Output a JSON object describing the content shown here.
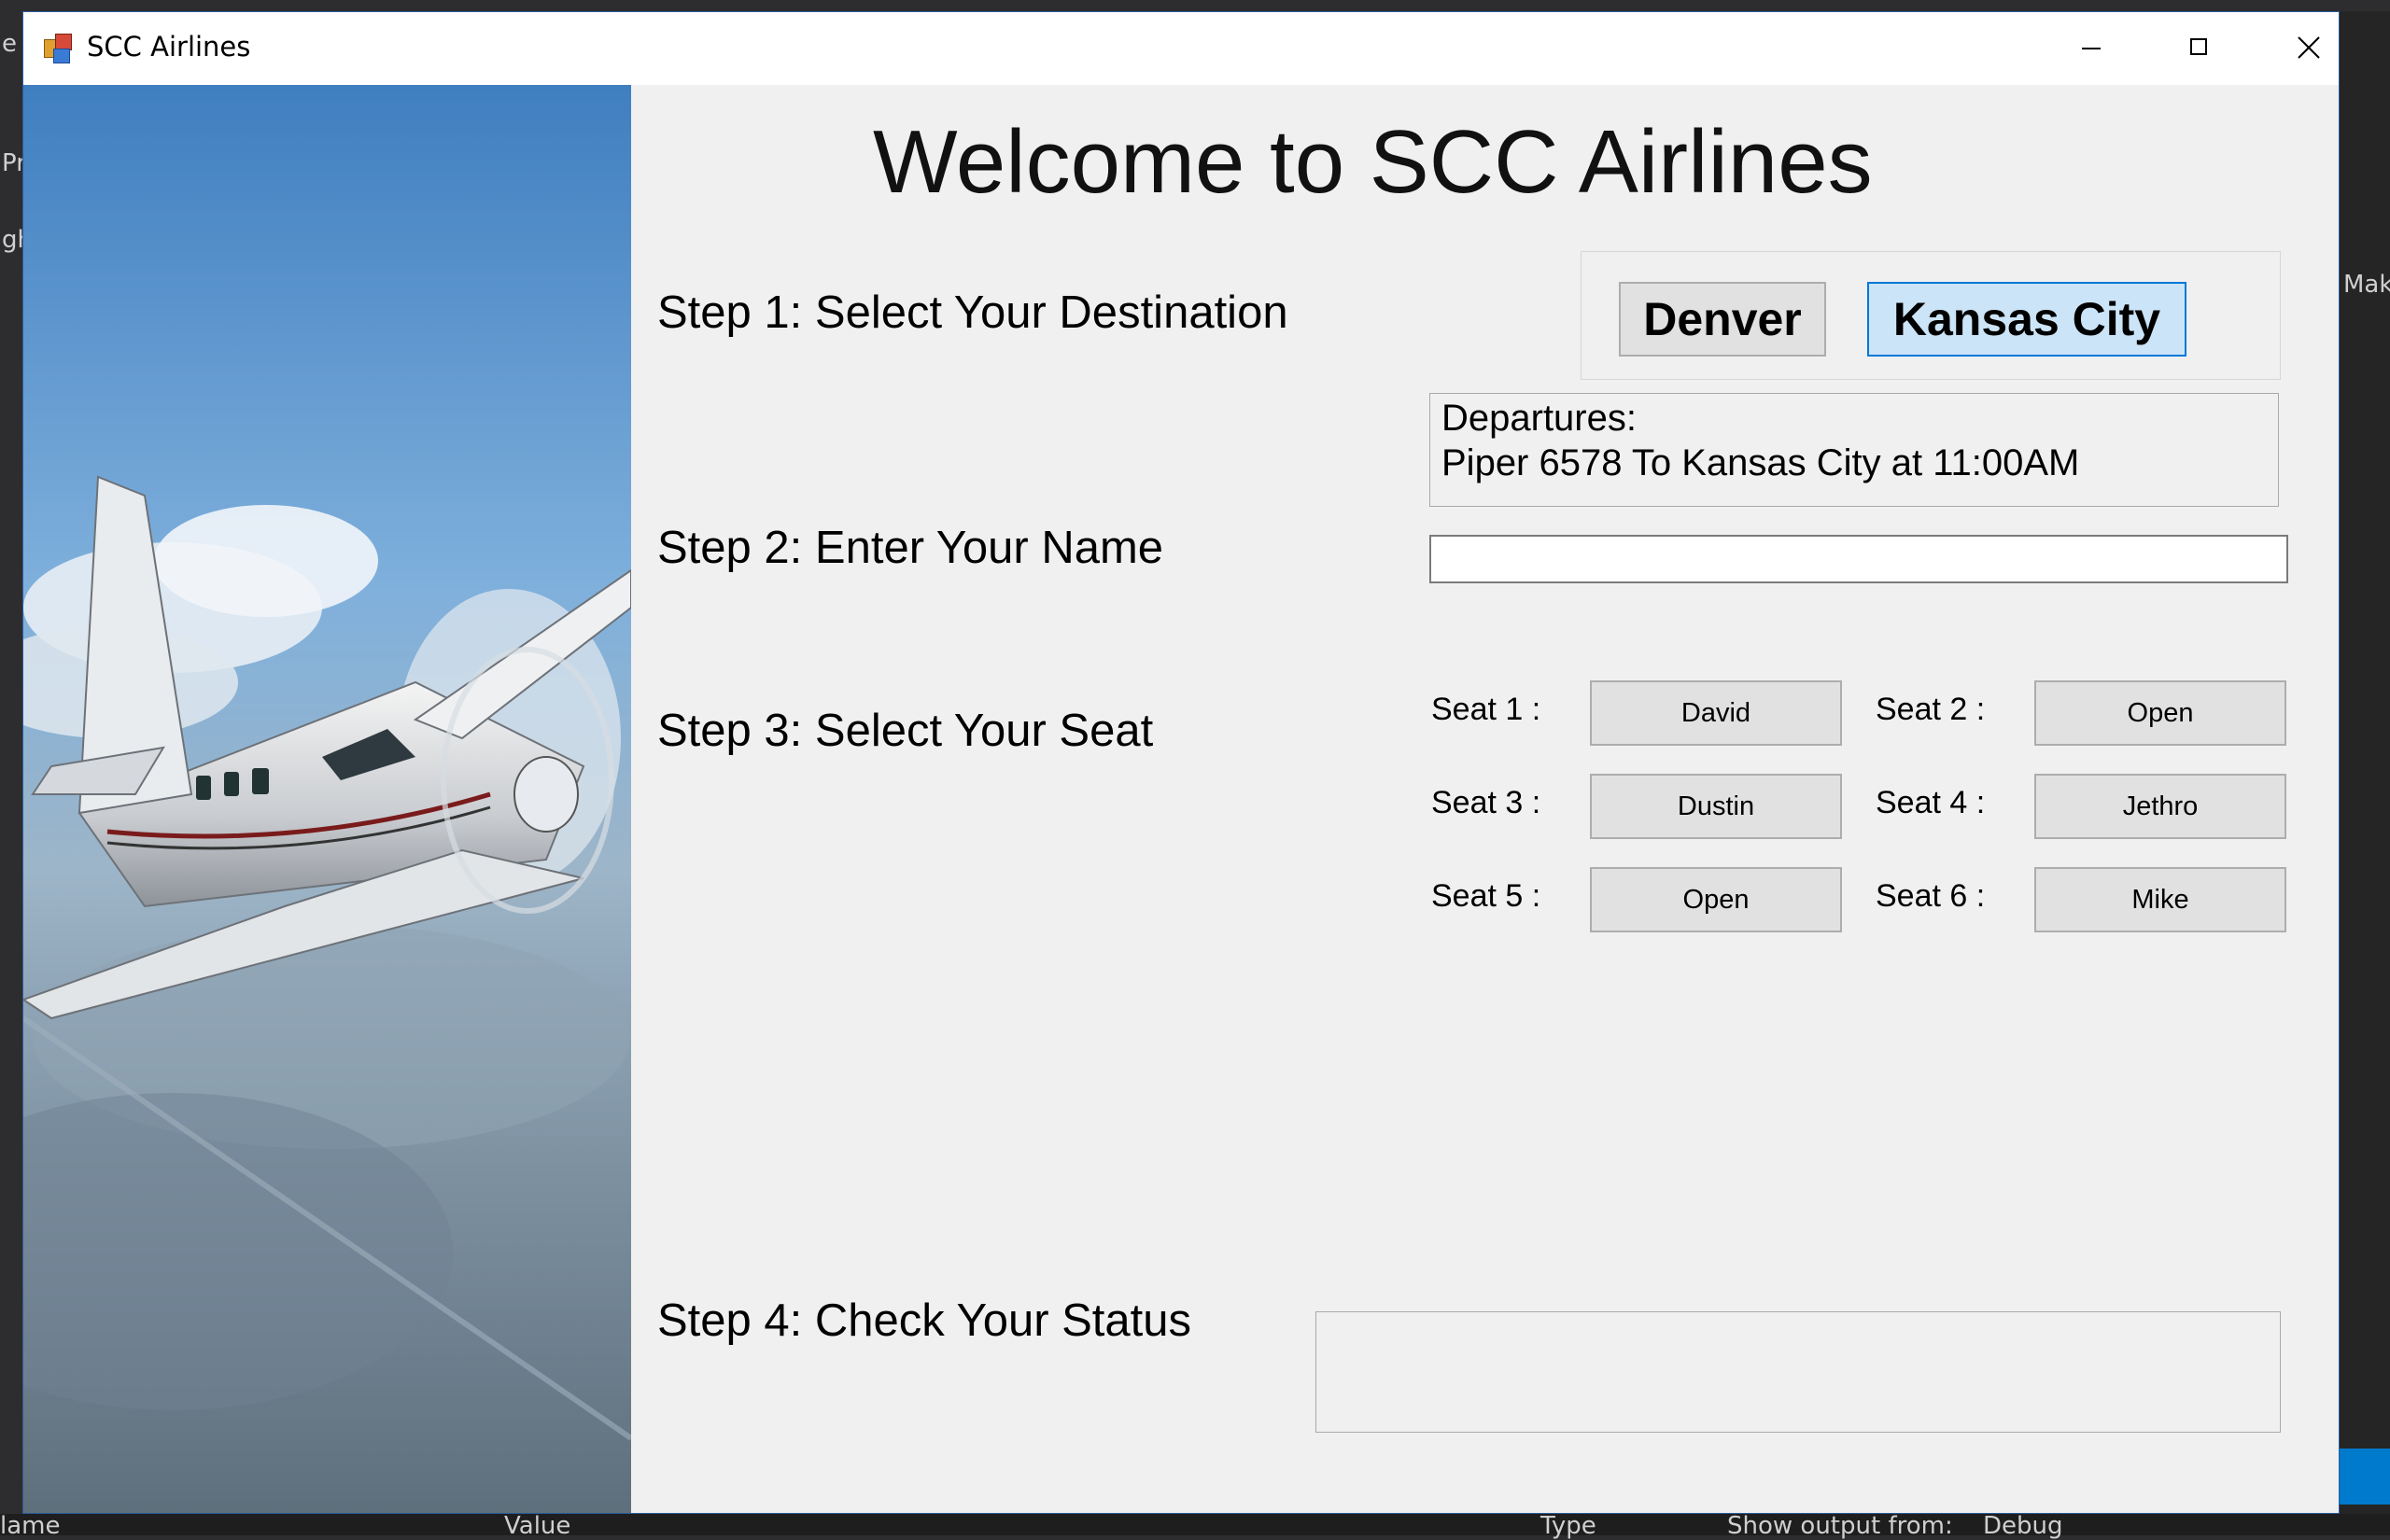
{
  "window": {
    "title": "SCC Airlines"
  },
  "heading": "Welcome to SCC Airlines",
  "steps": {
    "step1": "Step 1: Select Your Destination",
    "step2": "Step 2: Enter Your Name",
    "step3": "Step 3: Select Your Seat",
    "step4": "Step 4: Check Your Status"
  },
  "destinations": [
    {
      "label": "Denver",
      "selected": false
    },
    {
      "label": "Kansas City",
      "selected": true
    }
  ],
  "departures": {
    "header": "Departures:",
    "flight": "Piper 6578 To Kansas City at 11:00AM"
  },
  "name_input": {
    "value": ""
  },
  "seats": [
    {
      "label": "Seat 1 :",
      "occupant": "David"
    },
    {
      "label": "Seat 2 :",
      "occupant": "Open"
    },
    {
      "label": "Seat 3 :",
      "occupant": "Dustin"
    },
    {
      "label": "Seat 4 :",
      "occupant": "Jethro"
    },
    {
      "label": "Seat 5 :",
      "occupant": "Open"
    },
    {
      "label": "Seat 6 :",
      "occupant": "Mike"
    }
  ],
  "status": {
    "text": ""
  },
  "background_ide": {
    "left_fragments": [
      "e",
      "Pr",
      "gh"
    ],
    "right_fragment": "Mak",
    "bottom_fragments": [
      "lame",
      "Value",
      "Type",
      "Show output from:",
      "Debug"
    ]
  },
  "colors": {
    "selected_button_bg": "#cce4f7",
    "selected_button_border": "#0078d7",
    "window_bg": "#f0f0f0"
  }
}
